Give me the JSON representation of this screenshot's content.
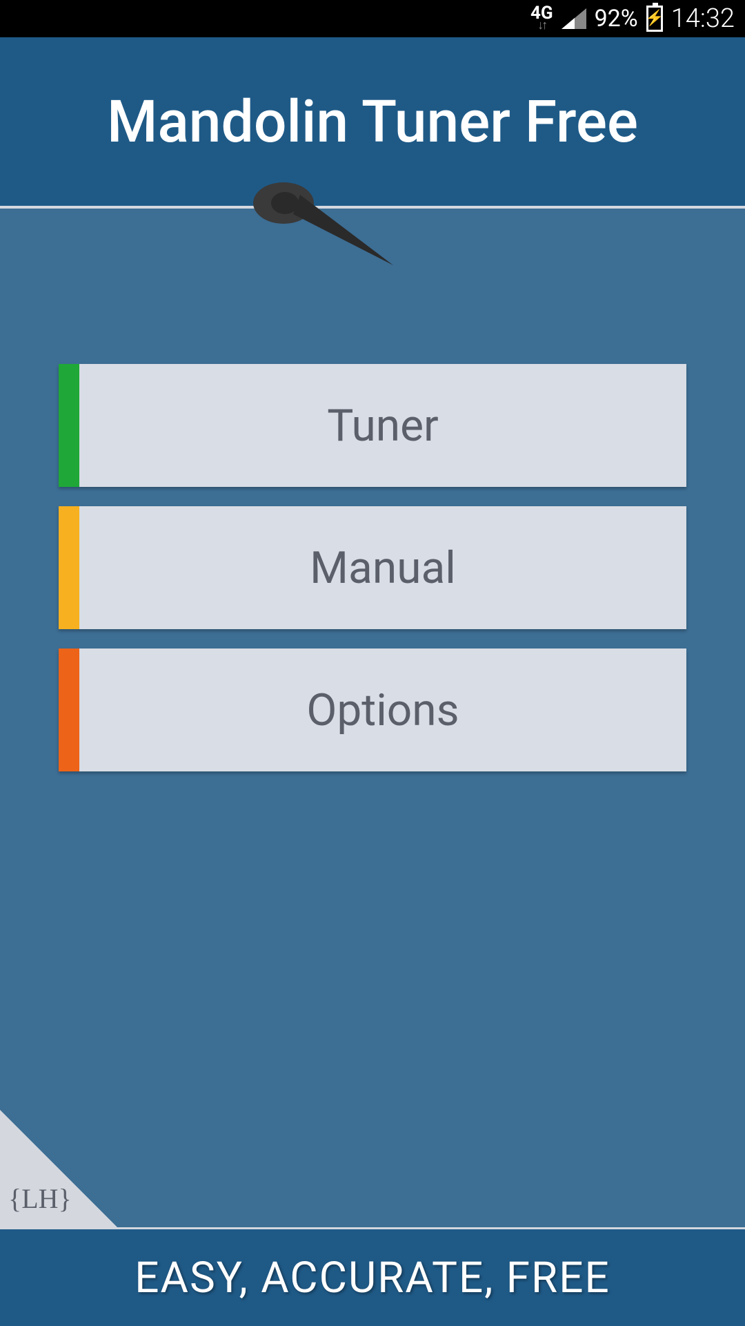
{
  "statusBar": {
    "network": "4G",
    "batteryPercent": "92%",
    "time": "14:32"
  },
  "header": {
    "title": "Mandolin Tuner Free"
  },
  "menu": {
    "items": [
      {
        "label": "Tuner",
        "accentColor": "#1fa838"
      },
      {
        "label": "Manual",
        "accentColor": "#f6b020"
      },
      {
        "label": "Options",
        "accentColor": "#ed6318"
      }
    ]
  },
  "corner": {
    "logo": "{LH}"
  },
  "footer": {
    "tagline": "EASY, ACCURATE, FREE"
  }
}
